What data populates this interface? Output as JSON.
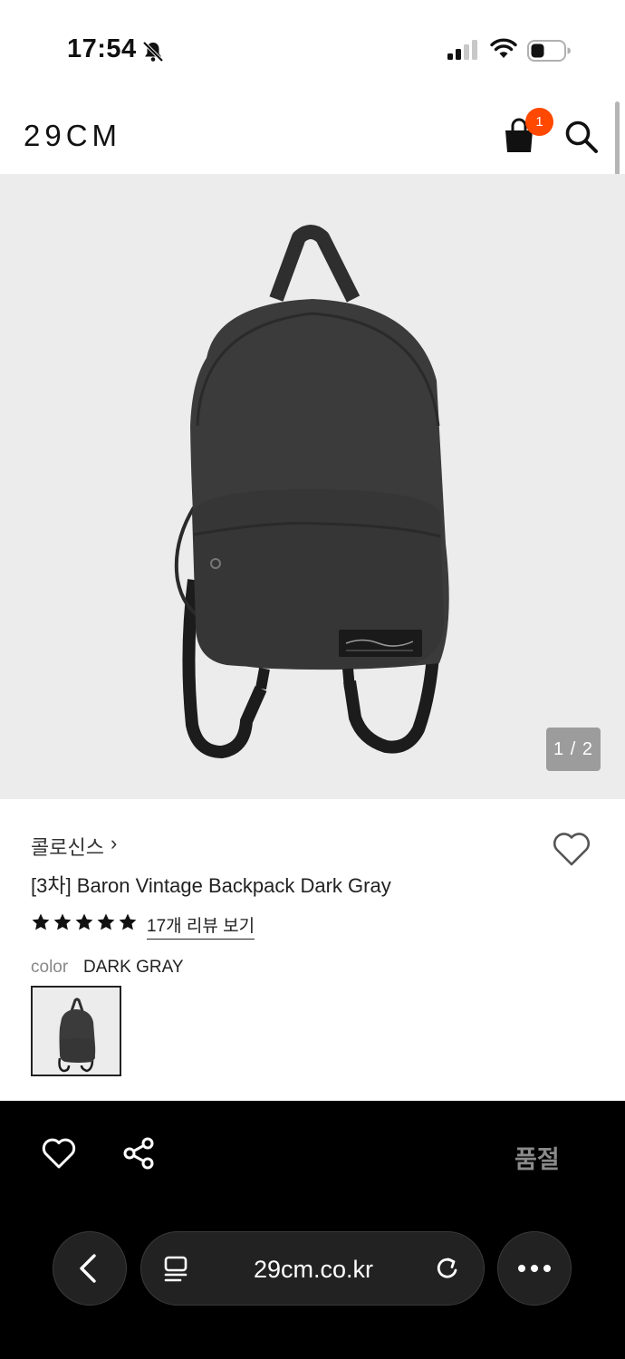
{
  "status_bar": {
    "time": "17:54"
  },
  "header": {
    "logo": "29CM",
    "cart_count": "1"
  },
  "gallery": {
    "pager": "1 / 2"
  },
  "product": {
    "brand": "콜로신스",
    "brand_chevron": "›",
    "title": "[3차] Baron Vintage Backpack Dark Gray",
    "rating_stars": 5,
    "review_link": "17개 리뷰 보기",
    "color_label": "color",
    "color_value": "DARK GRAY"
  },
  "action_bar": {
    "status_label": "품절"
  },
  "browser": {
    "url": "29cm.co.kr"
  },
  "colors": {
    "badge": "#ff4800",
    "hero_bg": "#ececec",
    "bag": "#3b3b3b"
  }
}
